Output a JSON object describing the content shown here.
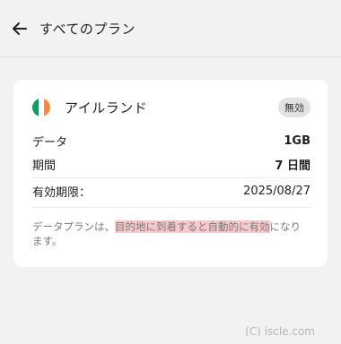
{
  "header": {
    "back_icon": "arrow-left-icon",
    "title": "すべてのプラン"
  },
  "plan": {
    "country": "アイルランド",
    "flag_icon": "ireland-flag-icon",
    "flag_colors": [
      "#169b62",
      "#ffffff",
      "#ff883e"
    ],
    "status": "無効",
    "rows": [
      {
        "label": "データ",
        "value": "1GB"
      },
      {
        "label": "期間",
        "value": "7 日間"
      },
      {
        "label": "有効期限：",
        "value": "2025/08/27"
      }
    ],
    "note_before": "データプランは、",
    "note_highlight": "目的地に到着すると自動的に有効",
    "note_after": "になります。",
    "highlight_color": "#f8c9cc"
  },
  "footer": {
    "copyright": "(C) iscle.com"
  }
}
